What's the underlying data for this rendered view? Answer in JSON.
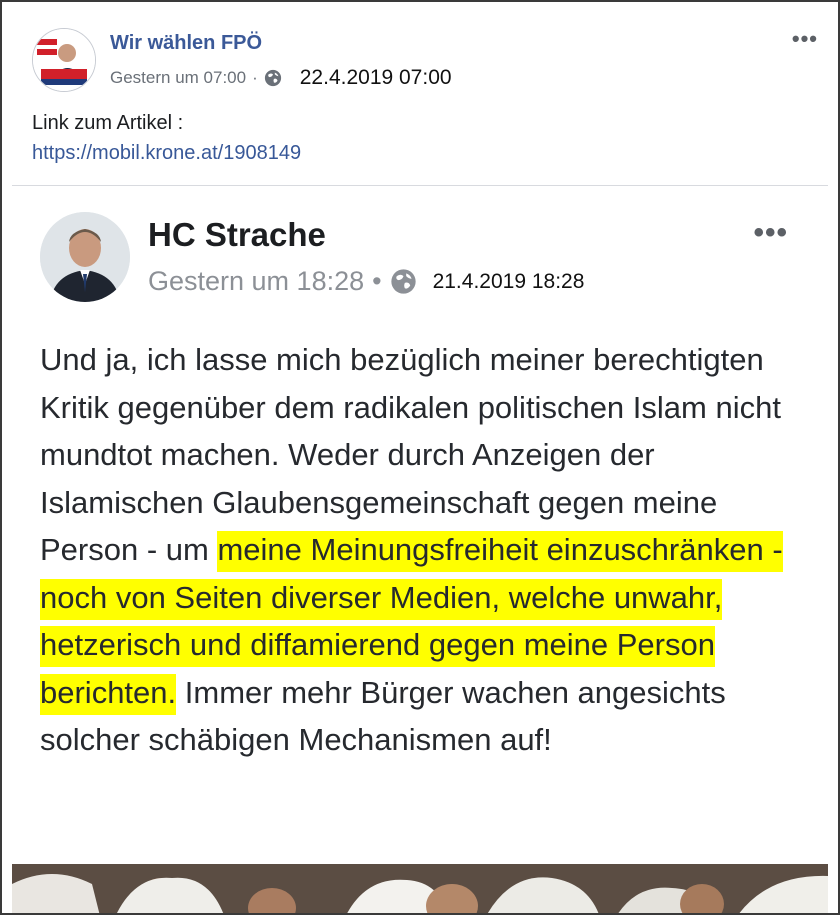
{
  "post": {
    "page_name": "Wir wählen FPÖ",
    "timestamp": "Gestern um 07:00",
    "separator": "·",
    "annotation_date": "22.4.2019  07:00",
    "more": "•••",
    "link_label": "Link zum Artikel :",
    "link_url": "https://mobil.krone.at/1908149"
  },
  "shared_post": {
    "author": "HC Strache",
    "timestamp": "Gestern um 18:28",
    "separator": "•",
    "annotation_date": "21.4.2019  18:28",
    "more": "•••",
    "text_before": "Und ja, ich lasse mich bezüglich meiner berechtigten Kritik gegenüber dem radikalen politischen Islam nicht mundtot machen. Weder durch Anzeigen der Islamischen Glaubensgemeinschaft gegen meine Person - um ",
    "text_highlighted": "meine Meinungsfreiheit einzuschränken - noch von Seiten diverser Medien, welche unwahr, hetzerisch und diffamierend gegen meine Person berichten.",
    "text_after": " Immer mehr Bürger wachen angesichts solcher schäbigen Mechanismen auf!",
    "highlight_color": "#ffff00"
  },
  "colors": {
    "page_name": "#3b5998",
    "link": "#385898",
    "meta_gray": "#8c9096"
  },
  "icons": {
    "privacy": "globe-icon",
    "menu": "more-options-icon"
  }
}
